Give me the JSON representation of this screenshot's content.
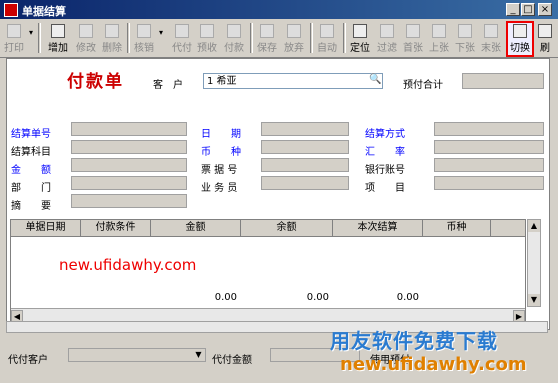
{
  "window": {
    "title": "单据结算",
    "controls": [
      "_",
      "□",
      "×"
    ]
  },
  "toolbar": {
    "buttons": [
      {
        "label": "打印",
        "icon": "printer-icon",
        "enabled": false
      },
      {
        "label": "增加",
        "icon": "add-icon",
        "enabled": true
      },
      {
        "label": "修改",
        "icon": "edit-icon",
        "enabled": false
      },
      {
        "label": "删除",
        "icon": "delete-icon",
        "enabled": false
      },
      {
        "label": "核销",
        "icon": "verify-icon",
        "enabled": false
      },
      {
        "label": "代付",
        "icon": "proxy-pay-icon",
        "enabled": false
      },
      {
        "label": "预收",
        "icon": "prepay-icon",
        "enabled": false
      },
      {
        "label": "付款",
        "icon": "payment-icon",
        "enabled": false
      },
      {
        "label": "保存",
        "icon": "save-icon",
        "enabled": false
      },
      {
        "label": "放弃",
        "icon": "discard-icon",
        "enabled": false
      },
      {
        "label": "自动",
        "icon": "auto-icon",
        "enabled": false
      },
      {
        "label": "定位",
        "icon": "locate-icon",
        "enabled": true
      },
      {
        "label": "过滤",
        "icon": "filter-icon",
        "enabled": false
      },
      {
        "label": "首张",
        "icon": "first-icon",
        "enabled": false
      },
      {
        "label": "上张",
        "icon": "prev-icon",
        "enabled": false
      },
      {
        "label": "下张",
        "icon": "next-icon",
        "enabled": false
      },
      {
        "label": "末张",
        "icon": "last-icon",
        "enabled": false
      },
      {
        "label": "切换",
        "icon": "switch-icon",
        "enabled": true
      },
      {
        "label": "刷",
        "icon": "refresh-icon",
        "enabled": true
      }
    ]
  },
  "form": {
    "doc_title": "付款单",
    "customer_label": "客　户",
    "customer_value": "1  希亚",
    "prepay_total_label": "预付合计",
    "labels": {
      "settle_no": "结算单号",
      "settle_subject": "结算科目",
      "amount": "金　　额",
      "dept": "部　　门",
      "summary": "摘　　要",
      "date": "日　　期",
      "currency": "币　　种",
      "bill_no": "票 据 号",
      "salesman": "业 务 员",
      "settle_method": "结算方式",
      "rate": "汇　　率",
      "bank_account": "银行账号",
      "project": "项　　目"
    }
  },
  "grid": {
    "columns": [
      "单据日期",
      "付款条件",
      "金额",
      "余额",
      "本次结算",
      "币种"
    ],
    "totals": [
      "0.00",
      "0.00",
      "0.00"
    ]
  },
  "watermark": {
    "url_text": "new.ufidawhy.com",
    "brand_text": "用友软件免费下载",
    "brand_url": "new.ufidawhy.com"
  },
  "bottom": {
    "proxy_customer_label": "代付客户",
    "proxy_amount_label": "代付金额",
    "use_prepay_label": "使用预付"
  }
}
